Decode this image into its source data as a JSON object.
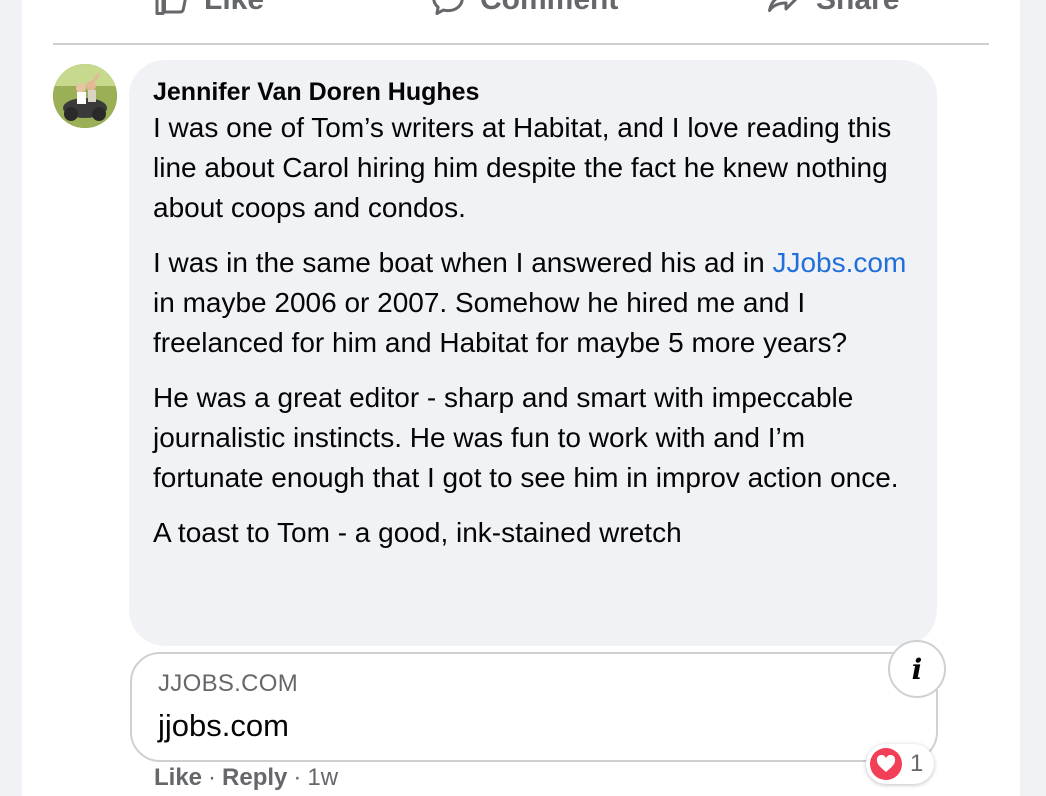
{
  "actions": {
    "like_label": "Like",
    "comment_label": "Comment",
    "share_label": "Share"
  },
  "comment": {
    "author": "Jennifer Van Doren Hughes",
    "paragraph1": "I was one of Tom’s writers at Habitat, and I love reading this line about Carol hiring him despite the fact he knew nothing about coops and condos.",
    "paragraph2_before_link": "I was in the same boat when I answered his ad in ",
    "paragraph2_link": "JJobs.com",
    "paragraph2_after_link": " in maybe 2006 or 2007. Somehow he hired me and I freelanced for him and Habitat for maybe 5 more years?",
    "paragraph3": "He was a great editor - sharp and smart with impeccable journalistic instincts. He was fun to work with and I’m fortunate enough that I got to see him in improv action once.",
    "paragraph4": "A toast to Tom - a good, ink-stained wretch"
  },
  "link_preview": {
    "domain": "JJOBS.COM",
    "title": "jjobs.com",
    "info_label": "i"
  },
  "reactions": {
    "count": "1",
    "icon": "heart-icon",
    "color": "#f33e58"
  },
  "footer": {
    "like_label": "Like",
    "separator1": "·",
    "reply_label": "Reply",
    "separator2": "·",
    "time": "1w"
  },
  "colors": {
    "link": "#216fdb",
    "bubble": "#f0f2f5",
    "secondary_text": "#65676b"
  }
}
